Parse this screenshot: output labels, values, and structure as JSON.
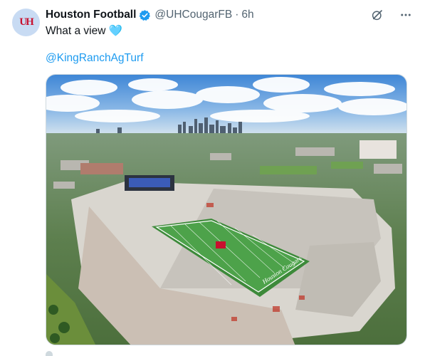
{
  "post": {
    "author_name": "Houston Football",
    "handle": "@UHCougarFB",
    "separator": "·",
    "time": "6h",
    "text": "What a view 🩵",
    "mention": "@KingRanchAgTurf"
  },
  "avatar": {
    "logo_text": "UH"
  },
  "stadium_signage": {
    "field_script": "Houston Cougars"
  },
  "icons": {
    "verified": "verified-badge-icon",
    "grok": "grok-icon",
    "more": "more-options-icon"
  },
  "colors": {
    "accent": "#1d9bf0",
    "brand_red": "#c8102e",
    "muted": "#536471"
  }
}
